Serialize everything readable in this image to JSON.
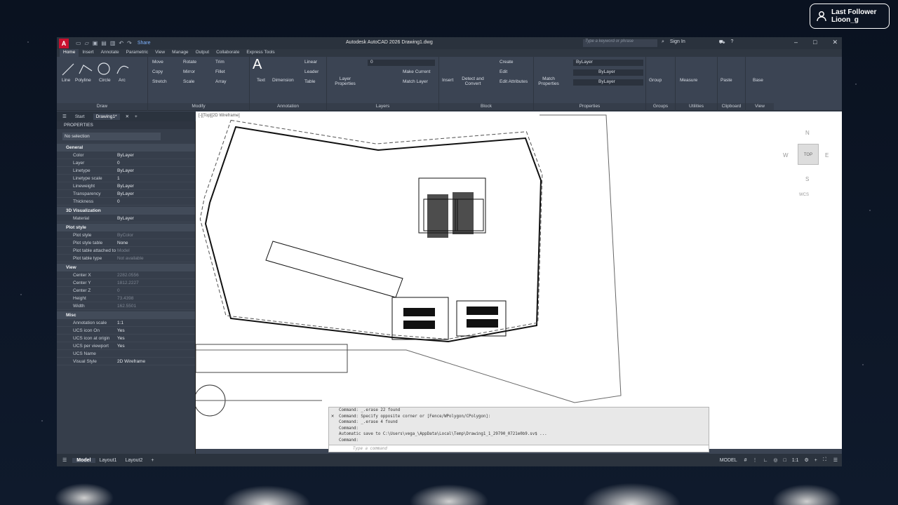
{
  "overlay": {
    "follower_title": "Last Follower",
    "follower_name": "Lioon_g"
  },
  "titlebar": {
    "logo": "A",
    "share": "Share",
    "title": "Autodesk AutoCAD 2026   Drawing1.dwg",
    "search_placeholder": "Type a keyword or phrase",
    "sign_in": "Sign In"
  },
  "ribbon_tabs": [
    "Home",
    "Insert",
    "Annotate",
    "Parametric",
    "View",
    "Manage",
    "Output",
    "Collaborate",
    "Express Tools"
  ],
  "ribbon": {
    "draw": {
      "title": "Draw",
      "line": "Line",
      "polyline": "Polyline",
      "circle": "Circle",
      "arc": "Arc"
    },
    "modify": {
      "title": "Modify",
      "move": "Move",
      "rotate": "Rotate",
      "trim": "Trim",
      "copy": "Copy",
      "mirror": "Mirror",
      "fillet": "Fillet",
      "stretch": "Stretch",
      "scale": "Scale",
      "array": "Array"
    },
    "annotation": {
      "title": "Annotation",
      "text": "Text",
      "dimension": "Dimension",
      "linear": "Linear",
      "leader": "Leader",
      "table": "Table"
    },
    "layers": {
      "title": "Layers",
      "layer_properties": "Layer Properties",
      "current_layer": "0",
      "make_current": "Make Current",
      "match_layer": "Match Layer"
    },
    "block": {
      "title": "Block",
      "insert": "Insert",
      "detect": "Detect and Convert",
      "create": "Create",
      "edit": "Edit",
      "edit_attributes": "Edit Attributes"
    },
    "properties": {
      "title": "Properties",
      "match": "Match Properties",
      "bylayer1": "ByLayer",
      "bylayer2": "ByLayer",
      "bylayer3": "ByLayer"
    },
    "groups": {
      "title": "Groups",
      "group": "Group"
    },
    "utilities": {
      "title": "Utilities",
      "measure": "Measure"
    },
    "clipboard": {
      "title": "Clipboard",
      "paste": "Paste"
    },
    "view": {
      "title": "View",
      "base": "Base"
    }
  },
  "doctabs": {
    "start": "Start",
    "drawing": "Drawing1*"
  },
  "properties": {
    "header": "PROPERTIES",
    "selection": "No selection",
    "sections": {
      "general": {
        "title": "General",
        "rows": [
          [
            "Color",
            "ByLayer"
          ],
          [
            "Layer",
            "0"
          ],
          [
            "Linetype",
            "ByLayer"
          ],
          [
            "Linetype scale",
            "1"
          ],
          [
            "Lineweight",
            "ByLayer"
          ],
          [
            "Transparency",
            "ByLayer"
          ],
          [
            "Thickness",
            "0"
          ]
        ]
      },
      "viz": {
        "title": "3D Visualization",
        "rows": [
          [
            "Material",
            "ByLayer"
          ]
        ]
      },
      "plot": {
        "title": "Plot style",
        "rows": [
          [
            "Plot style",
            "ByColor"
          ],
          [
            "Plot style table",
            "None"
          ],
          [
            "Plot table attached to",
            "Model"
          ],
          [
            "Plot table type",
            "Not available"
          ]
        ]
      },
      "view": {
        "title": "View",
        "rows": [
          [
            "Center X",
            "2282.0556"
          ],
          [
            "Center Y",
            "1812.2227"
          ],
          [
            "Center Z",
            "0"
          ],
          [
            "Height",
            "73.4398"
          ],
          [
            "Width",
            "162.5501"
          ]
        ]
      },
      "misc": {
        "title": "Misc",
        "rows": [
          [
            "Annotation scale",
            "1:1"
          ],
          [
            "UCS icon On",
            "Yes"
          ],
          [
            "UCS icon at origin",
            "Yes"
          ],
          [
            "UCS per viewport",
            "Yes"
          ],
          [
            "UCS Name",
            ""
          ],
          [
            "Visual Style",
            "2D Wireframe"
          ]
        ]
      }
    }
  },
  "canvas": {
    "viewport_label": "[-][Top][2D Wireframe]",
    "viewcube": {
      "top": "TOP",
      "n": "N",
      "s": "S",
      "e": "E",
      "w": "W",
      "wcs": "WCS"
    }
  },
  "command": {
    "lines": [
      "Command: _.erase 22 found",
      "Command: Specify opposite corner or [Fence/WPolygon/CPolygon]:",
      "Command: _.erase 4 found",
      "Command:",
      "Automatic save to C:\\Users\\vega_\\AppData\\Local\\Temp\\Drawing1_1_29790_0721e0b9.sv$ ...",
      "Command:"
    ],
    "placeholder": "Type a command"
  },
  "status": {
    "model": "Model",
    "layout1": "Layout1",
    "layout2": "Layout2",
    "mode": "MODEL",
    "scale": "1:1"
  }
}
